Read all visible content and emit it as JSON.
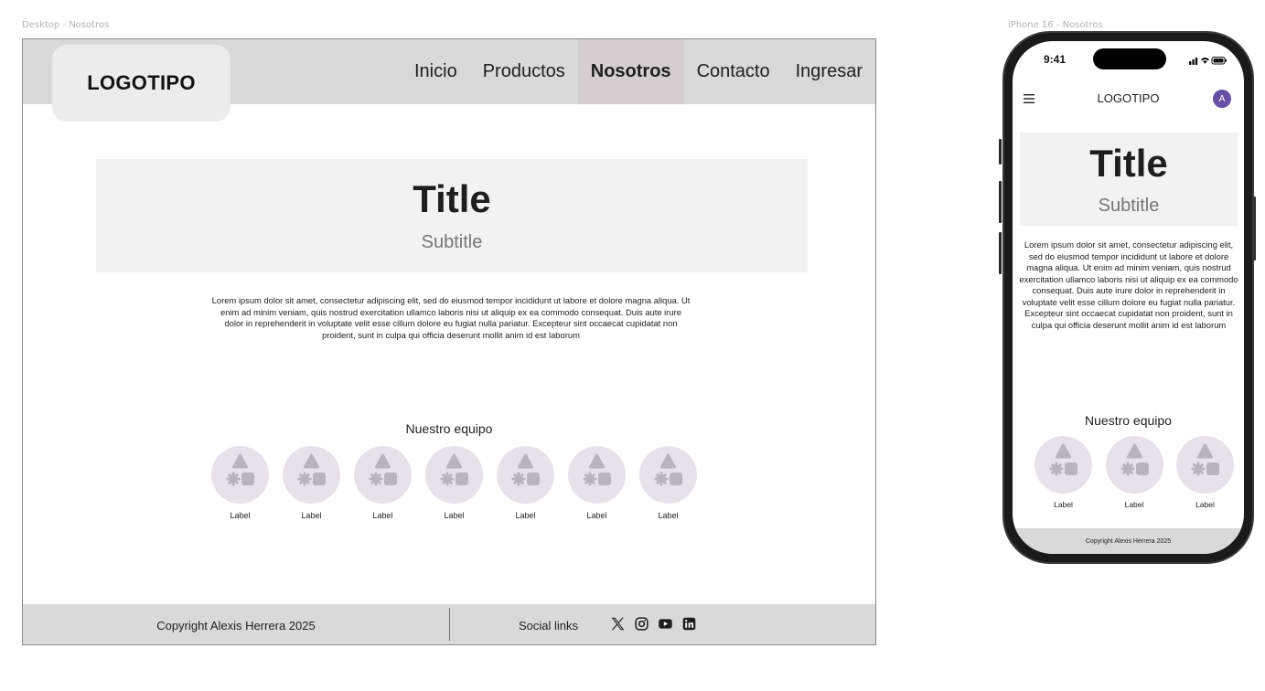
{
  "frames": {
    "desktop_label": "Desktop - Nosotros",
    "phone_label": "iPhone 16 - Nosotros"
  },
  "desktop": {
    "logo": "LOGOTIPO",
    "nav": [
      {
        "label": "Inicio",
        "active": false
      },
      {
        "label": "Productos",
        "active": false
      },
      {
        "label": "Nosotros",
        "active": true
      },
      {
        "label": "Contacto",
        "active": false
      },
      {
        "label": "Ingresar",
        "active": false
      }
    ],
    "hero": {
      "title": "Title",
      "subtitle": "Subtitle"
    },
    "body": "Lorem ipsum dolor sit amet, consectetur adipiscing elit, sed do eiusmod tempor incididunt ut labore et dolore magna aliqua. Ut enim ad minim veniam, quis nostrud exercitation ullamco laboris nisi ut aliquip ex ea commodo consequat. Duis aute irure dolor in reprehenderit in voluptate velit esse cillum dolore eu fugiat nulla pariatur. Excepteur sint occaecat cupidatat non proident, sunt in culpa qui officia deserunt mollit anim id est laborum",
    "team": {
      "title": "Nuestro equipo",
      "members": [
        "Label",
        "Label",
        "Label",
        "Label",
        "Label",
        "Label",
        "Label"
      ]
    },
    "footer": {
      "copyright": "Copyright Alexis Herrera 2025",
      "social_label": "Social links",
      "social_icons": [
        "x-icon",
        "instagram-icon",
        "youtube-icon",
        "linkedin-icon"
      ]
    }
  },
  "phone": {
    "time": "9:41",
    "logo": "LOGOTIPO",
    "avatar_initial": "A",
    "hero": {
      "title": "Title",
      "subtitle": "Subtitle"
    },
    "body": "Lorem ipsum dolor sit amet, consectetur adipiscing elit, sed do eiusmod tempor incididunt ut labore et dolore magna aliqua. Ut enim ad minim veniam, quis nostrud exercitation ullamco laboris nisi ut aliquip ex ea commodo consequat. Duis aute irure dolor in reprehenderit in voluptate velit esse cillum dolore eu fugiat nulla pariatur. Excepteur sint occaecat cupidatat non proident, sunt in culpa qui officia deserunt mollit anim id est laborum",
    "team": {
      "title": "Nuestro equipo",
      "members": [
        "Label",
        "Label",
        "Label"
      ]
    },
    "footer": {
      "copyright": "Copyright Alexis Herrera 2025"
    }
  },
  "colors": {
    "header_bg": "#d9d9d9",
    "nav_active_bg": "#d6cece",
    "hero_bg": "#f2f2f2",
    "avatar_placeholder_bg": "#e7e1ec",
    "avatar_placeholder_shapes": "#b8b3bd",
    "phone_avatar": "#6750a4"
  }
}
